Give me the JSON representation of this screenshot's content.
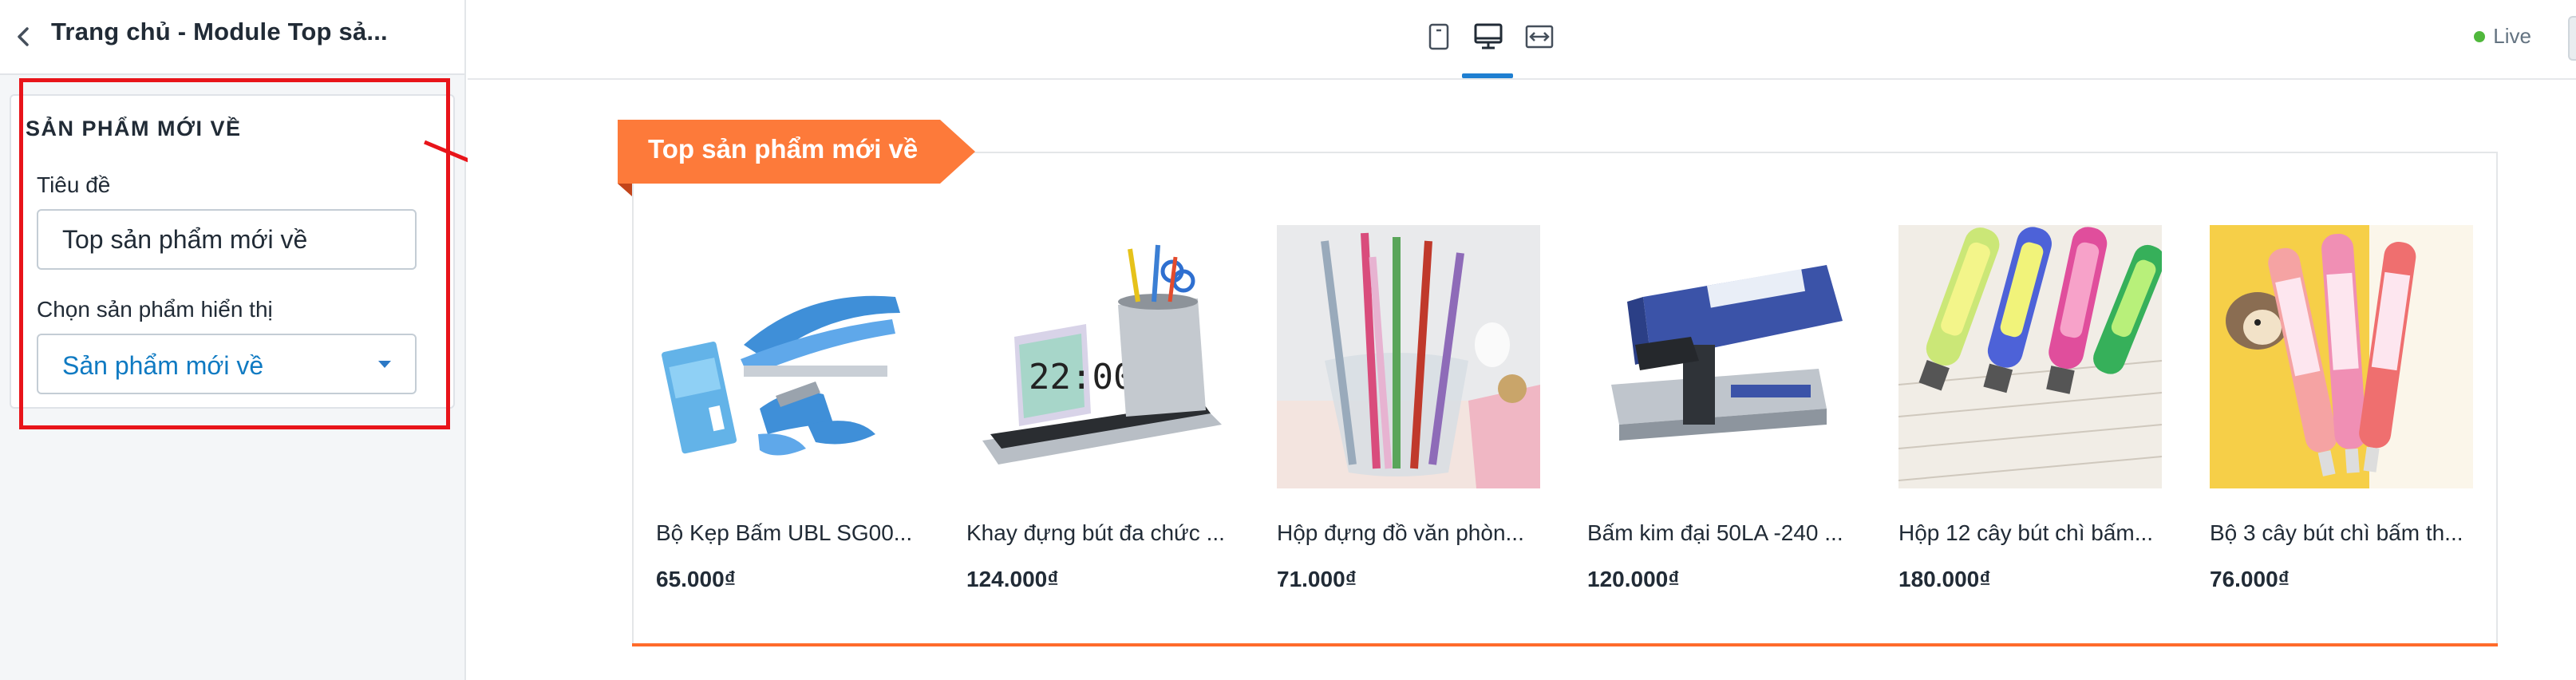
{
  "panel": {
    "title": "Trang chủ - Module Top sả...",
    "section_heading": "SẢN PHẨM MỚI VỀ",
    "title_label": "Tiêu đề",
    "title_value": "Top sản phẩm mới về",
    "select_label": "Chọn sản phẩm hiển thị",
    "select_value": "Sản phẩm mới về"
  },
  "toolbar": {
    "views": [
      "mobile-view-icon",
      "desktop-view-icon",
      "fullwidth-view-icon"
    ],
    "active_view": "desktop",
    "status": "Live"
  },
  "module": {
    "ribbon_title": "Top sản phẩm mới về",
    "products": [
      {
        "name": "Bộ Kẹp Bấm UBL SG00...",
        "price": "65.000₫"
      },
      {
        "name": "Khay đựng bút đa chức ...",
        "price": "124.000₫"
      },
      {
        "name": "Hộp đựng đồ văn phòn...",
        "price": "71.000₫"
      },
      {
        "name": "Bấm kim đại 50LA -240 ...",
        "price": "120.000₫"
      },
      {
        "name": "Hộp 12 cây bút chì bấm...",
        "price": "180.000₫"
      },
      {
        "name": "Bộ 3 cây bút chì bấm th...",
        "price": "76.000₫"
      }
    ]
  },
  "colors": {
    "accent_orange": "#fd7a3a",
    "link_blue": "#0f7ac2",
    "annotation_red": "#e8141a",
    "live_green": "#50b83c"
  }
}
